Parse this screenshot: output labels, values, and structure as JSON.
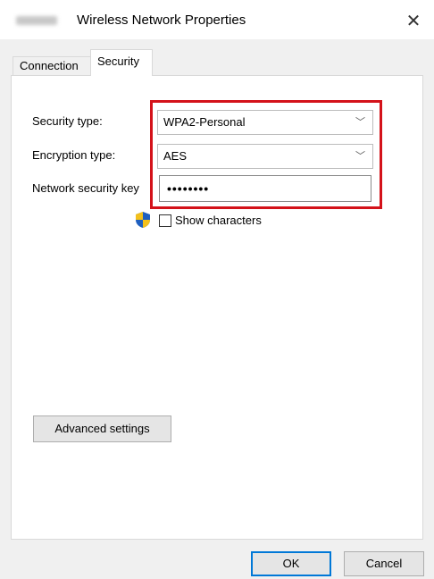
{
  "window": {
    "title": "Wireless Network Properties",
    "close_glyph": "✕"
  },
  "tabs": [
    {
      "label": "Connection",
      "active": false
    },
    {
      "label": "Security",
      "active": true
    }
  ],
  "security": {
    "security_type_label": "Security type:",
    "security_type_value": "WPA2-Personal",
    "encryption_type_label": "Encryption type:",
    "encryption_type_value": "AES",
    "network_key_label": "Network security key",
    "network_key_value": "••••••••",
    "show_characters_label": "Show characters",
    "show_characters_checked": false
  },
  "buttons": {
    "advanced": "Advanced settings",
    "ok": "OK",
    "cancel": "Cancel"
  },
  "colors": {
    "highlight": "#d4121a",
    "accent": "#0078d7"
  },
  "icons": {
    "shield": "uac-shield-icon",
    "dropdown": "chevron-down-icon",
    "close": "close-icon"
  }
}
